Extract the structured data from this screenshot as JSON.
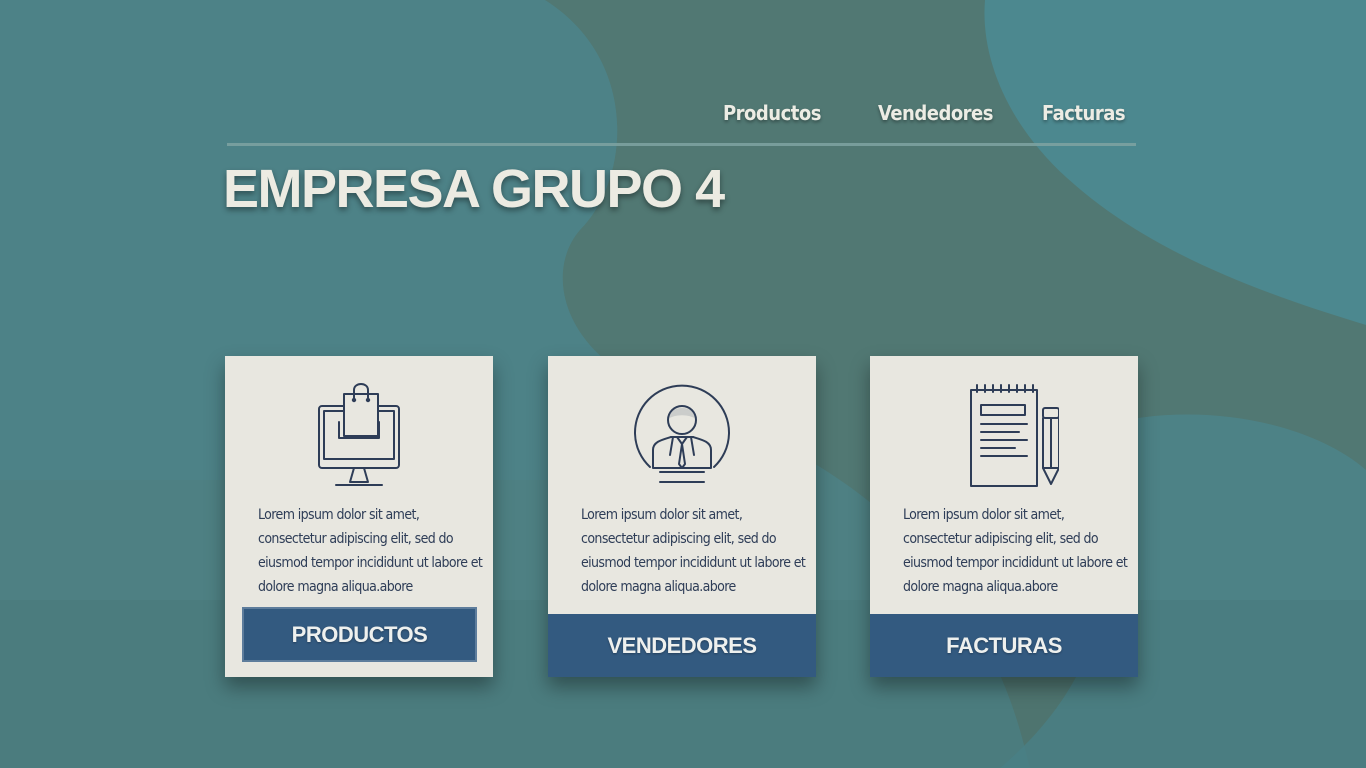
{
  "nav": {
    "items": [
      {
        "label": "Productos"
      },
      {
        "label": "Vendedores"
      },
      {
        "label": "Facturas"
      }
    ]
  },
  "header": {
    "title": "EMPRESA GRUPO 4"
  },
  "cards": [
    {
      "icon": "shopping-computer-icon",
      "text": "Lorem ipsum dolor sit amet, consectetur adipiscing elit, sed do eiusmod tempor incididunt ut labore et dolore magna aliqua.abore",
      "button_label": "PRODUCTOS"
    },
    {
      "icon": "salesperson-avatar-icon",
      "text": "Lorem ipsum dolor sit amet, consectetur adipiscing elit, sed do eiusmod tempor incididunt ut labore et dolore magna aliqua.abore",
      "button_label": "VENDEDORES"
    },
    {
      "icon": "invoice-pencil-icon",
      "text": "Lorem ipsum dolor sit amet, consectetur adipiscing elit, sed do eiusmod tempor incididunt ut labore et dolore magna aliqua.abore",
      "button_label": "FACTURAS"
    }
  ],
  "colors": {
    "background": "#517873",
    "blob": "#4d878f",
    "card": "#e8e7e0",
    "button": "#335a80",
    "icon_stroke": "#2e3d57",
    "title": "#ecebe2"
  }
}
